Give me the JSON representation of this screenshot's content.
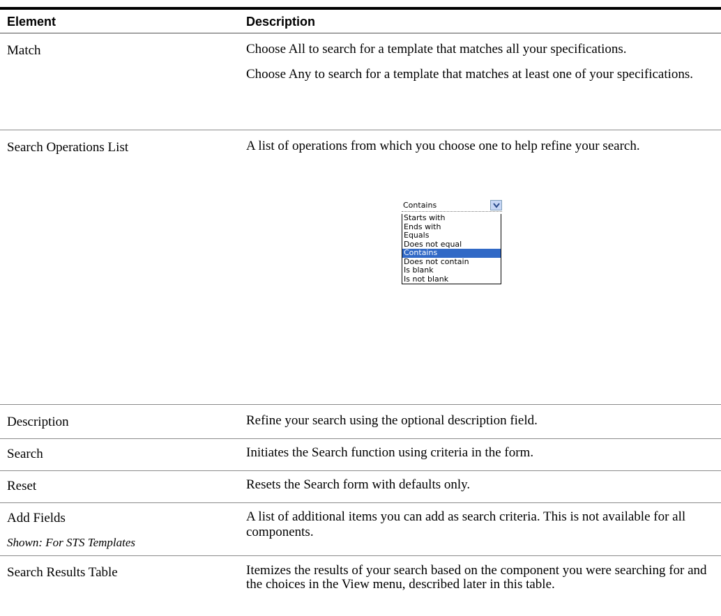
{
  "table": {
    "header": {
      "element": "Element",
      "description": "Description"
    },
    "rows": [
      {
        "element": "Match",
        "description": [
          "Choose All to search for a template that matches all your specifications.",
          "Choose Any to search for a template that matches at least one of your specifications."
        ]
      },
      {
        "element": "Search Operations List",
        "description": [
          "A list of operations from which you choose one to help refine your search."
        ]
      },
      {
        "element": "Description",
        "description": [
          "Refine your search using the optional description field."
        ]
      },
      {
        "element": "Search",
        "description": [
          "Initiates the Search function using criteria in the form."
        ]
      },
      {
        "element": "Reset",
        "description": [
          "Resets the Search form with defaults only."
        ]
      },
      {
        "element": "Add Fields",
        "shown_note": "Shown: For STS Templates",
        "description": [
          "A list of additional items you can add as search criteria. This is not available for all components."
        ]
      },
      {
        "element": "Search Results Table",
        "description": [
          "Itemizes the results of your search based on the component you were searching for and the choices in the View menu, described later in this table."
        ]
      }
    ]
  },
  "operations_dropdown": {
    "selected": "Contains",
    "options": [
      "Starts with",
      "Ends with",
      "Equals",
      "Does not equal",
      "Contains",
      "Does not contain",
      "Is blank",
      "Is not blank"
    ],
    "highlight_color": "#3169c6",
    "button_icon": "chevron-down-icon"
  }
}
